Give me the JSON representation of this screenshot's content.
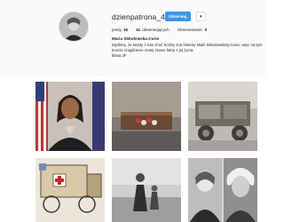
{
  "profile": {
    "username": "dzienpatrona_4lo",
    "follow_label": "Obserwuj",
    "more_label": "▾",
    "stats": [
      {
        "value": "16",
        "label": "posty"
      },
      {
        "value": "41",
        "label": "obserwujących"
      },
      {
        "value": "0",
        "label": "Obserwowani:"
      }
    ],
    "bio_name": "Maria Skłodowska-Curie",
    "bio_lines": [
      "Myślimy, że każdy z nas choć trochę zna historię Marii Skłodowskiej-Curie, więc na tym",
      "koncie znajdziecie mniej znane fakty z jej życia.",
      "klasa 2F"
    ]
  },
  "grid": {
    "posts": [
      {
        "subject": "portrait-woman-flags"
      },
      {
        "subject": "coffin-with-flowers"
      },
      {
        "subject": "vintage-car-photo"
      },
      {
        "subject": "red-cross-vehicle-illustration"
      },
      {
        "subject": "woman-child-field-photo"
      },
      {
        "subject": "curie-einstein-portraits"
      }
    ]
  },
  "colors": {
    "accent": "#3897f0",
    "header_bg": "#fafafa",
    "border": "#dbdbdb"
  }
}
